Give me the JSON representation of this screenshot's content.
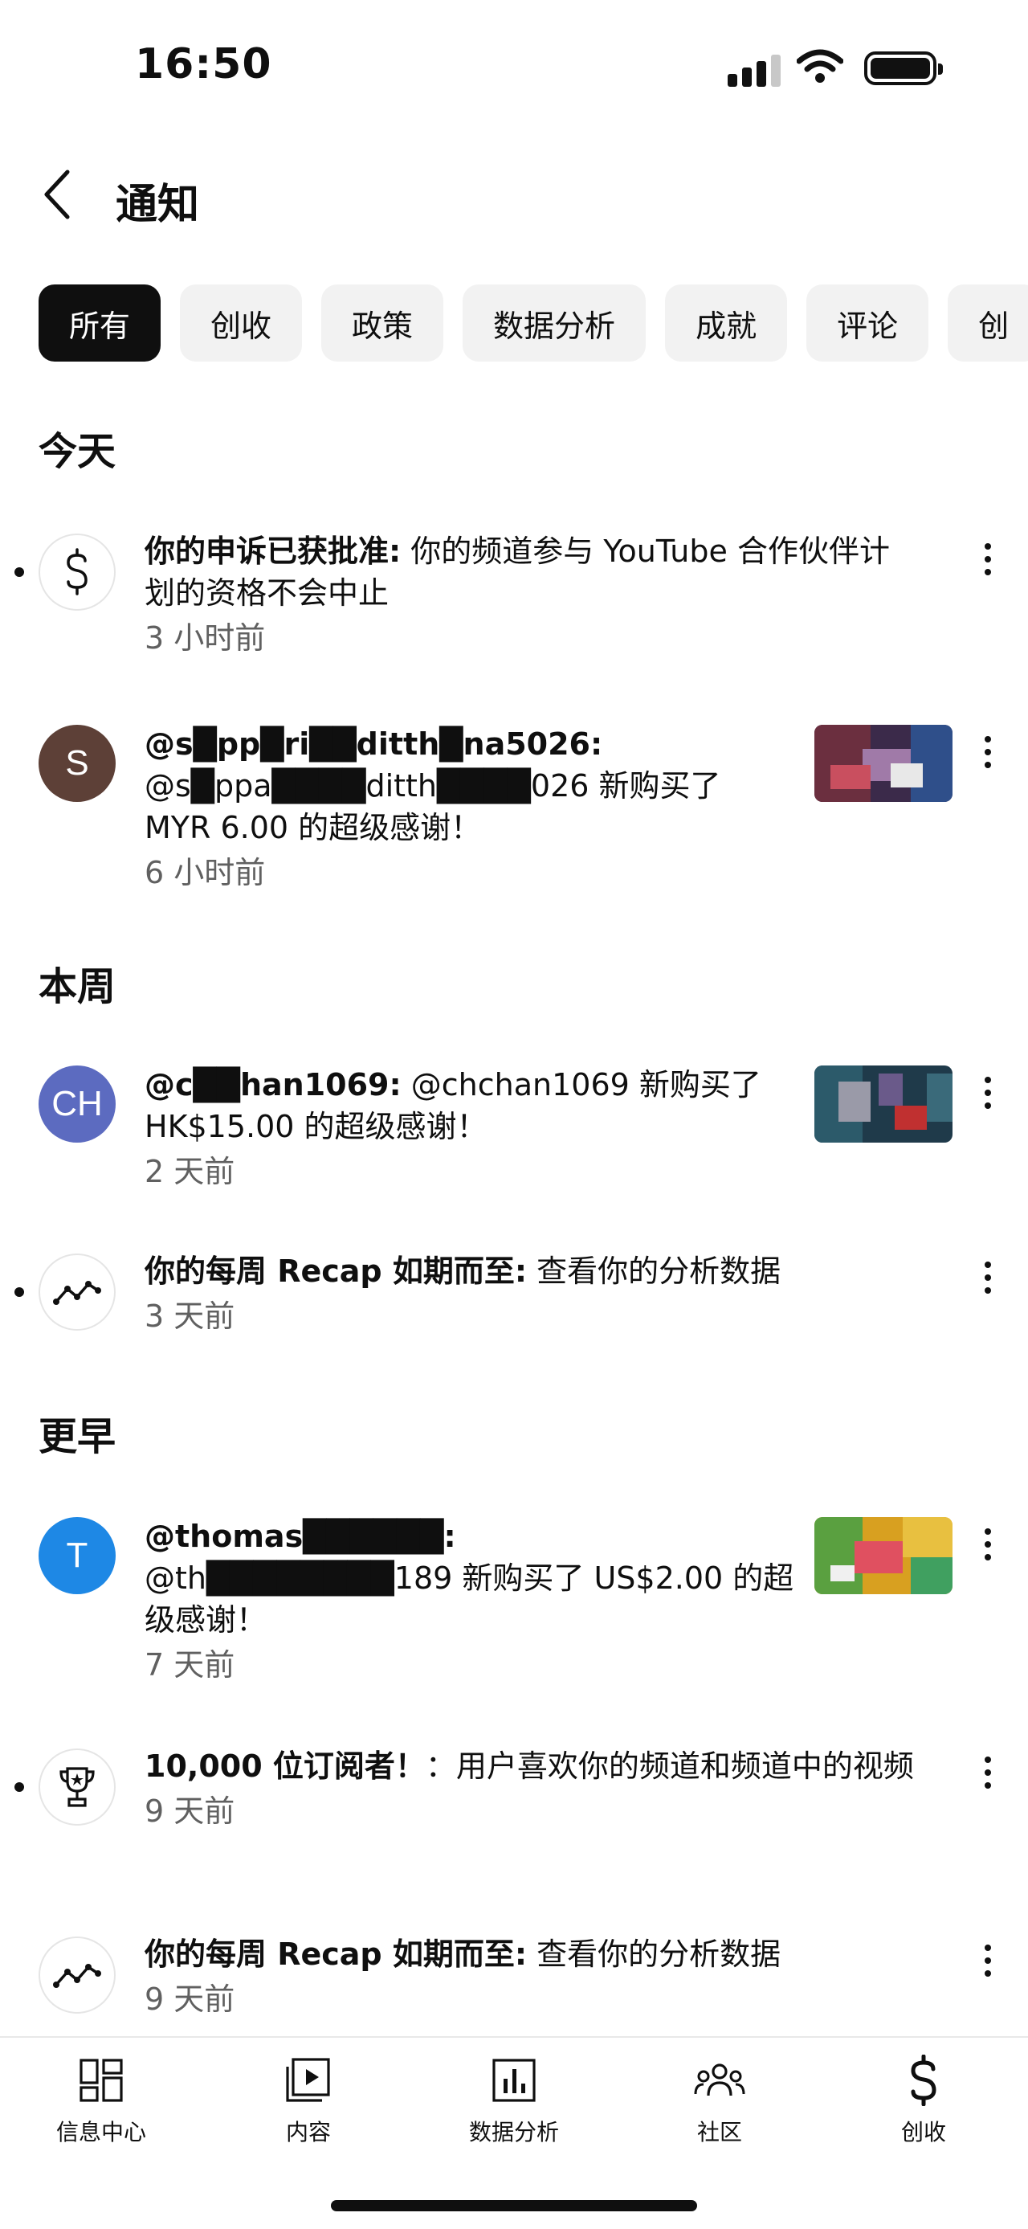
{
  "status_bar": {
    "time": "16:50"
  },
  "header": {
    "title": "通知"
  },
  "chips": [
    {
      "label": "所有",
      "active": true
    },
    {
      "label": "创收",
      "active": false
    },
    {
      "label": "政策",
      "active": false
    },
    {
      "label": "数据分析",
      "active": false
    },
    {
      "label": "成就",
      "active": false
    },
    {
      "label": "评论",
      "active": false
    },
    {
      "label": "创",
      "active": false
    }
  ],
  "sections": {
    "today": "今天",
    "this_week": "本周",
    "earlier": "更早"
  },
  "notifications": [
    {
      "icon": "dollar-icon",
      "title": "你的申诉已获批准:",
      "body": " 你的频道参与 YouTube 合作伙伴计划的资格不会中止",
      "time": "3 小时前",
      "unread": true
    },
    {
      "avatar_letter": "S",
      "avatar_color": "#5d4037",
      "title": "@s█pp█ri██ditth█na5026:",
      "body": "@s█ppa████ditth████026 新购买了 MYR 6.00 的超级感谢！",
      "time": "6 小时前",
      "unread": false
    },
    {
      "avatar_letter": "CH",
      "avatar_color": "#5c6bc0",
      "title": "@c██han1069:",
      "body": " @chchan1069 新购买了 HK$15.00 的超级感谢！",
      "time": "2 天前",
      "unread": false
    },
    {
      "icon": "analytics-trend-icon",
      "title": "你的每周 Recap 如期而至:",
      "body": " 查看你的分析数据",
      "time": "3 天前",
      "unread": true
    },
    {
      "avatar_letter": "T",
      "avatar_color": "#1e88e5",
      "title": "@thomas██████:",
      "body": "@th████████189 新购买了 US$2.00 的超级感谢！",
      "time": "7 天前",
      "unread": false
    },
    {
      "icon": "trophy-icon",
      "title": "10,000 位订阅者！",
      "body": "：用户喜欢你的频道和频道中的视频",
      "time": "9 天前",
      "unread": true
    },
    {
      "icon": "analytics-trend-icon",
      "title": "你的每周 Recap 如期而至:",
      "body": " 查看你的分析数据",
      "time": "9 天前",
      "unread": false
    }
  ],
  "bottom_nav": [
    {
      "label": "信息中心",
      "icon": "dashboard-icon"
    },
    {
      "label": "内容",
      "icon": "content-icon"
    },
    {
      "label": "数据分析",
      "icon": "analytics-icon"
    },
    {
      "label": "社区",
      "icon": "community-icon"
    },
    {
      "label": "创收",
      "icon": "earn-icon"
    }
  ]
}
